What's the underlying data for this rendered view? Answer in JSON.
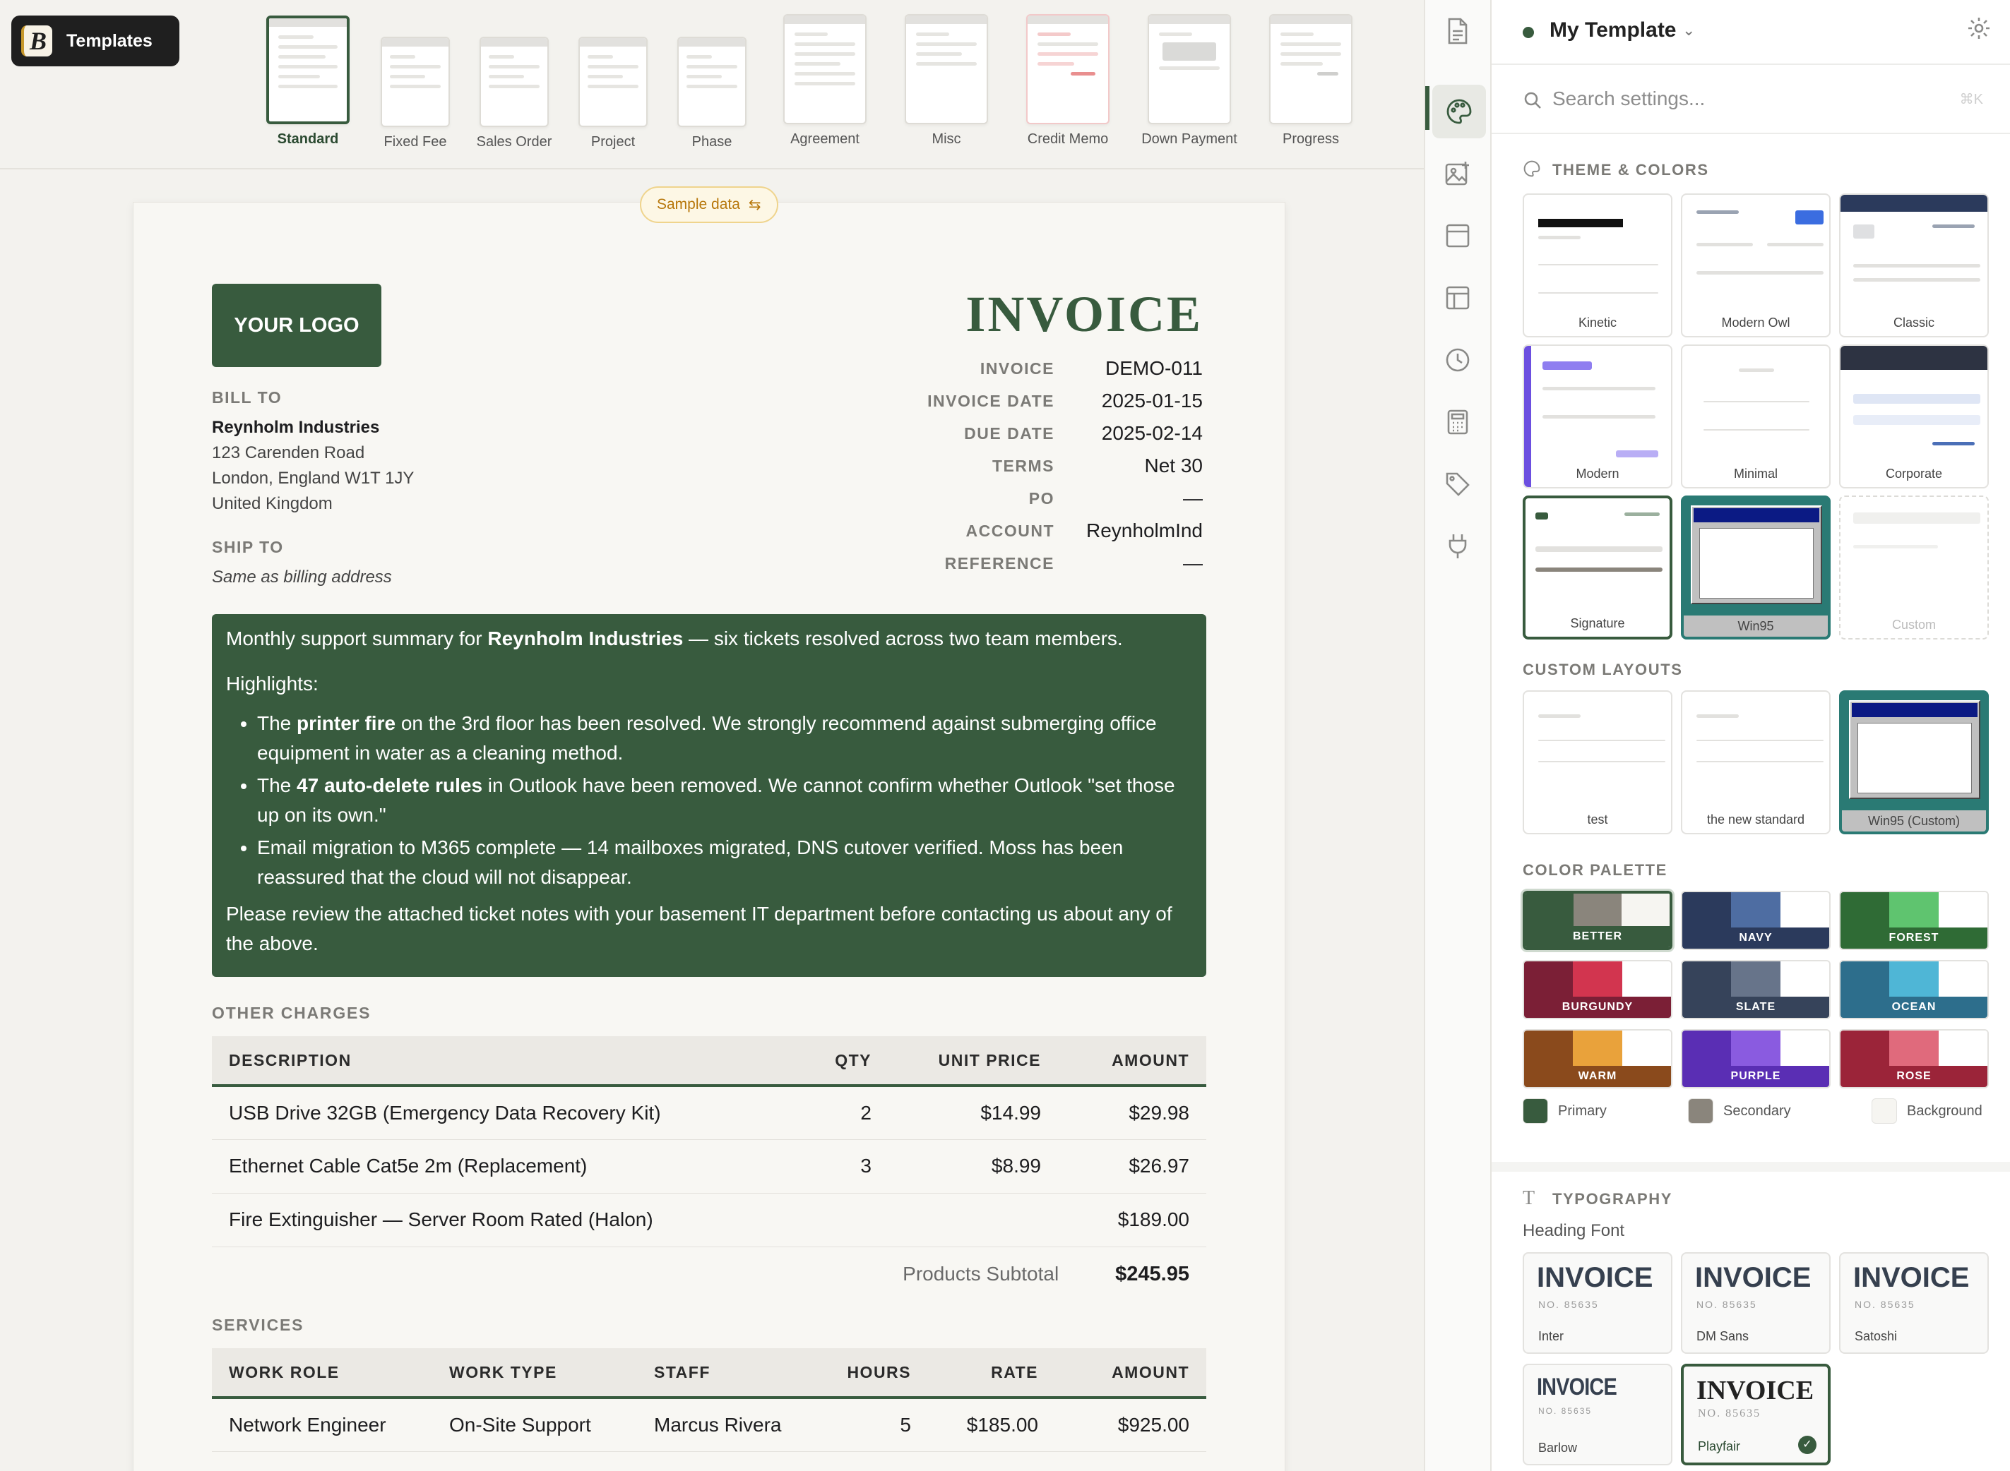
{
  "brand": {
    "label": "Templates",
    "mark": "B"
  },
  "template_types": [
    {
      "label": "Standard",
      "active": true
    },
    {
      "label": "Fixed Fee"
    },
    {
      "label": "Sales Order"
    },
    {
      "label": "Project"
    },
    {
      "label": "Phase"
    },
    {
      "label": "Agreement"
    },
    {
      "label": "Misc"
    },
    {
      "label": "Credit Memo"
    },
    {
      "label": "Down Payment"
    },
    {
      "label": "Progress"
    }
  ],
  "sample_pill": {
    "label": "Sample data"
  },
  "invoice": {
    "logo": "YOUR LOGO",
    "title": "INVOICE",
    "bill_to_label": "BILL TO",
    "bill_to": {
      "name": "Reynholm Industries",
      "line1": "123 Carenden Road",
      "line2": "London, England W1T 1JY",
      "line3": "United Kingdom"
    },
    "ship_to_label": "SHIP TO",
    "ship_to": "Same as billing address",
    "meta": [
      {
        "k": "INVOICE",
        "v": "DEMO-011"
      },
      {
        "k": "INVOICE DATE",
        "v": "2025-01-15"
      },
      {
        "k": "DUE DATE",
        "v": "2025-02-14"
      },
      {
        "k": "TERMS",
        "v": "Net 30"
      },
      {
        "k": "PO",
        "v": "—"
      },
      {
        "k": "ACCOUNT",
        "v": "ReynholmInd"
      },
      {
        "k": "REFERENCE",
        "v": "—"
      }
    ],
    "summary": {
      "intro_pre": "Monthly support summary for ",
      "intro_bold": "Reynholm Industries",
      "intro_post": " — six tickets resolved across two team members.",
      "highlights": "Highlights:",
      "b1_pre": "The ",
      "b1_bold": "printer fire",
      "b1_post": " on the 3rd floor has been resolved. We strongly recommend against submerging office equipment in water as a cleaning method.",
      "b2_pre": "The ",
      "b2_bold": "47 auto-delete rules",
      "b2_post": " in Outlook have been removed. We cannot confirm whether Outlook \"set those up on its own.\"",
      "b3": "Email migration to M365 complete — 14 mailboxes migrated, DNS cutover verified. Moss has been reassured that the cloud will not disappear.",
      "outro": "Please review the attached ticket notes with your basement IT department before contacting us about any of the above."
    },
    "other_charges": {
      "label": "OTHER CHARGES",
      "headers": [
        "DESCRIPTION",
        "QTY",
        "UNIT PRICE",
        "AMOUNT"
      ],
      "rows": [
        [
          "USB Drive 32GB (Emergency Data Recovery Kit)",
          "2",
          "$14.99",
          "$29.98"
        ],
        [
          "Ethernet Cable Cat5e 2m (Replacement)",
          "3",
          "$8.99",
          "$26.97"
        ],
        [
          "Fire Extinguisher — Server Room Rated (Halon)",
          "",
          "",
          "$189.00"
        ]
      ],
      "subtotal_label": "Products Subtotal",
      "subtotal": "$245.95"
    },
    "services": {
      "label": "SERVICES",
      "headers": [
        "WORK ROLE",
        "WORK TYPE",
        "STAFF",
        "HOURS",
        "RATE",
        "AMOUNT"
      ],
      "rows": [
        [
          "Network Engineer",
          "On-Site Support",
          "Marcus Rivera",
          "5",
          "$185.00",
          "$925.00"
        ]
      ]
    }
  },
  "panel": {
    "title": "My Template",
    "search_placeholder": "Search settings...",
    "search_shortcut": "⌘K",
    "theme_label": "THEME & COLORS",
    "themes": [
      "Kinetic",
      "Modern Owl",
      "Classic",
      "Modern",
      "Minimal",
      "Corporate",
      "Signature",
      "Win95",
      "Custom"
    ],
    "custom_label": "CUSTOM LAYOUTS",
    "custom_layouts": [
      "test",
      "the new standard",
      "Win95 (Custom)"
    ],
    "palette_label": "COLOR PALETTE",
    "palettes": [
      {
        "name": "BETTER",
        "c1": "#385b3e",
        "c2": "#8a857c",
        "c3": "#f6f5f1"
      },
      {
        "name": "NAVY",
        "c1": "#2b3a5c",
        "c2": "#4e6da2",
        "c3": "#ffffff"
      },
      {
        "name": "FOREST",
        "c1": "#2f6b35",
        "c2": "#5fc46f",
        "c3": "#ffffff"
      },
      {
        "name": "BURGUNDY",
        "c1": "#7b1f36",
        "c2": "#d2354f",
        "c3": "#ffffff"
      },
      {
        "name": "SLATE",
        "c1": "#36435a",
        "c2": "#67748a",
        "c3": "#ffffff"
      },
      {
        "name": "OCEAN",
        "c1": "#2d6e8c",
        "c2": "#4fb6d6",
        "c3": "#ffffff"
      },
      {
        "name": "WARM",
        "c1": "#8a4a1c",
        "c2": "#e9a23b",
        "c3": "#ffffff"
      },
      {
        "name": "PURPLE",
        "c1": "#5a2eb4",
        "c2": "#8a5be0",
        "c3": "#ffffff"
      },
      {
        "name": "ROSE",
        "c1": "#9b2439",
        "c2": "#e06a7c",
        "c3": "#ffffff"
      }
    ],
    "legend": [
      {
        "label": "Primary",
        "color": "#385b3e"
      },
      {
        "label": "Secondary",
        "color": "#8a857c"
      },
      {
        "label": "Background",
        "color": "#f6f5f1"
      }
    ],
    "typography_label": "TYPOGRAPHY",
    "heading_font_label": "Heading Font",
    "fonts": [
      {
        "sample": "INVOICE",
        "no": "NO. 85635",
        "name": "Inter"
      },
      {
        "sample": "INVOICE",
        "no": "NO. 85635",
        "name": "DM Sans"
      },
      {
        "sample": "INVOICE",
        "no": "NO. 85635",
        "name": "Satoshi"
      },
      {
        "sample": "INVOICE",
        "no": "NO. 85635",
        "name": "Barlow"
      },
      {
        "sample": "INVOICE",
        "no": "NO. 85635",
        "name": "Playfair",
        "selected": true
      }
    ]
  }
}
